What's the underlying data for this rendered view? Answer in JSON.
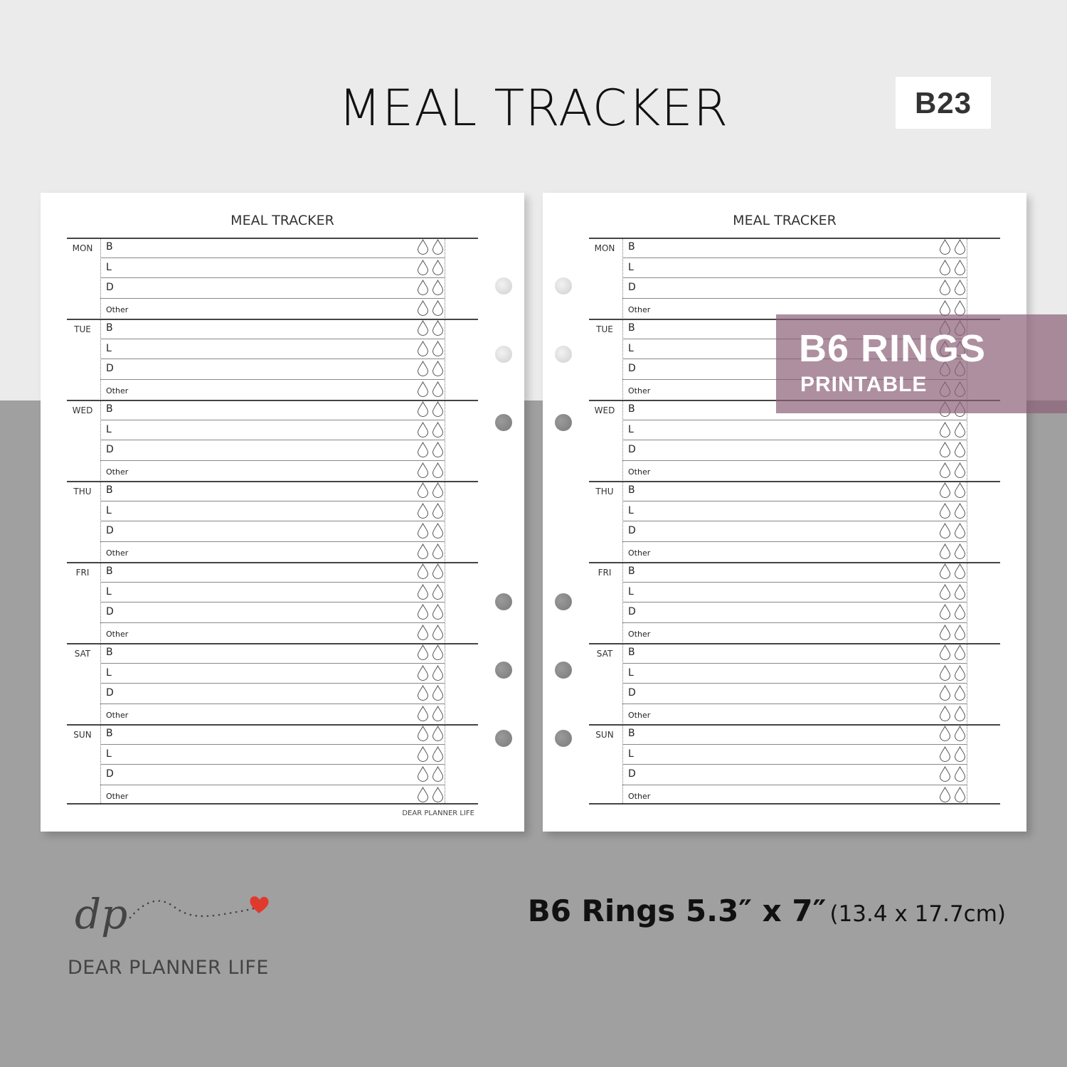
{
  "header": {
    "title": "MEAL TRACKER",
    "product_code": "B23"
  },
  "pages": [
    {
      "title": "MEAL TRACKER",
      "footer": "DEAR PLANNER LIFE"
    },
    {
      "title": "MEAL TRACKER",
      "footer": ""
    }
  ],
  "days": [
    "MON",
    "TUE",
    "WED",
    "THU",
    "FRI",
    "SAT",
    "SUN"
  ],
  "meals": [
    "B",
    "L",
    "D",
    "Other"
  ],
  "water_drops_per_meal": 2,
  "overlay": {
    "title": "B6 RINGS",
    "subtitle": "PRINTABLE",
    "color": "#a88a99"
  },
  "brand": {
    "monogram": "dp",
    "name": "DEAR PLANNER LIFE",
    "heart_color": "#e03a2f"
  },
  "size_info": {
    "main": "B6 Rings 5.3″ x 7″",
    "sub": "(13.4 x 17.7cm)"
  },
  "colors": {
    "background_top": "#ebebeb",
    "background_bottom": "#a0a0a0",
    "page": "#ffffff",
    "ink": "#333333"
  }
}
